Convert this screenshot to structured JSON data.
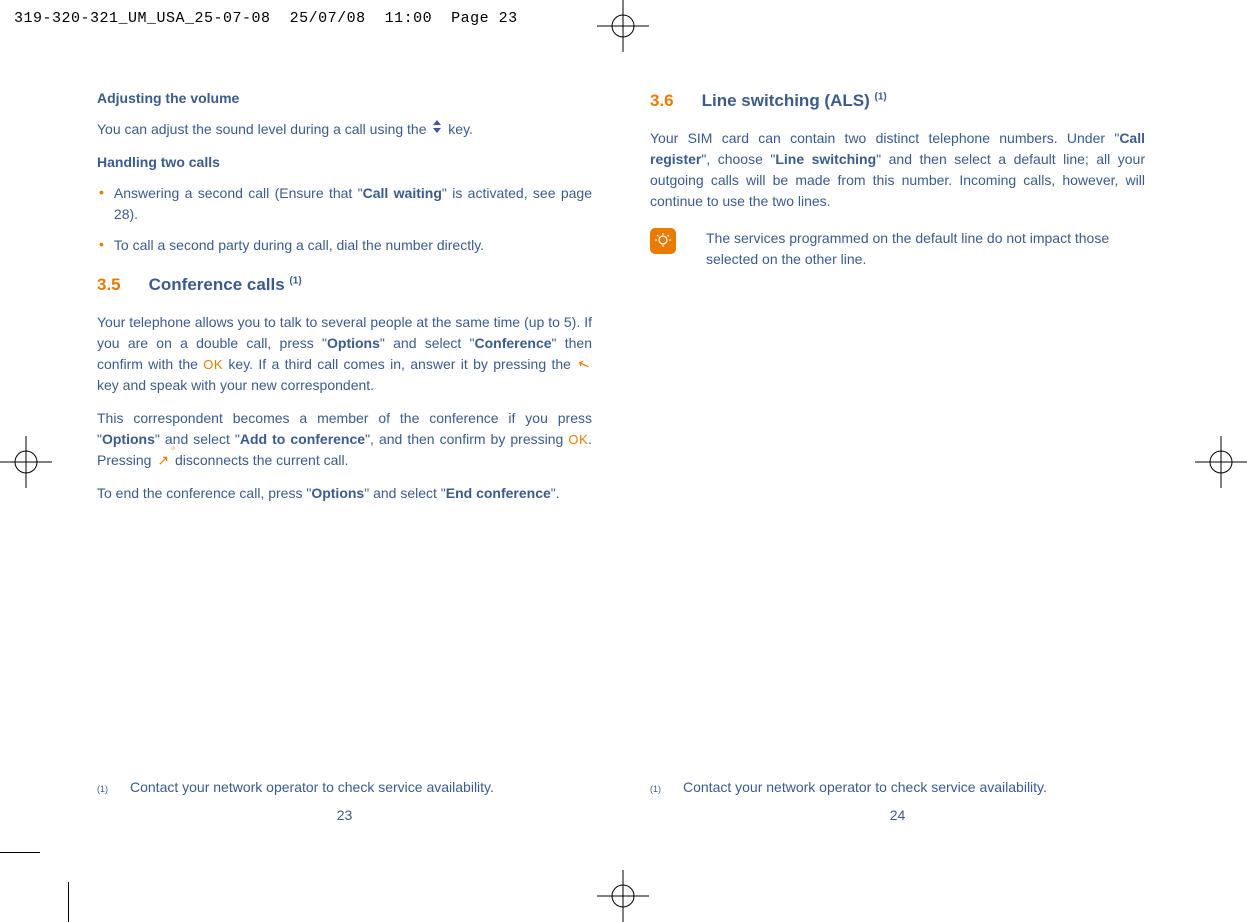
{
  "header": {
    "filename": "319-320-321_UM_USA_25-07-08",
    "date": "25/07/08",
    "time": "11:00",
    "page_label": "Page 23"
  },
  "left": {
    "h_volume": "Adjusting the volume",
    "p_volume_a": "You can adjust the sound level during a call using the ",
    "p_volume_b": " key.",
    "h_twocalls": "Handling two calls",
    "bullets": [
      {
        "pre": "Answering a second call (Ensure that \"",
        "bold": "Call waiting",
        "post": "\" is activated, see page 28)."
      },
      {
        "pre": "To call a second party during a call, dial the number directly.",
        "bold": "",
        "post": ""
      }
    ],
    "chapter_num": "3.5",
    "chapter_title": "Conference calls ",
    "chapter_sup": "(1)",
    "p_conf1_a": "Your telephone allows you to talk to several people at the same time (up to 5). If you are on a double call, press \"",
    "p_conf1_b": "Options",
    "p_conf1_c": "\" and select \"",
    "p_conf1_d": "Conference",
    "p_conf1_e": "\" then confirm with the ",
    "p_conf1_f": " key. If a third call comes in, answer it by pressing the ",
    "p_conf1_g": " key and speak with your new correspondent.",
    "p_conf2_a": "This correspondent becomes a member of the conference if you press \"",
    "p_conf2_b": "Options",
    "p_conf2_c": "\" and select \"",
    "p_conf2_d": "Add to conference",
    "p_conf2_e": "\", and then confirm by pressing ",
    "p_conf2_f": ". Pressing ",
    "p_conf2_g": " disconnects the current call.",
    "p_conf3_a": "To end the conference call, press \"",
    "p_conf3_b": "Options",
    "p_conf3_c": "\" and select \"",
    "p_conf3_d": "End conference",
    "p_conf3_e": "\".",
    "footnote_sup": "(1)",
    "footnote": "Contact your network operator to check service availability.",
    "page_num": "23"
  },
  "right": {
    "chapter_num": "3.6",
    "chapter_title": "Line switching (ALS) ",
    "chapter_sup": "(1)",
    "p_als_a": "Your SIM card can contain two distinct telephone numbers. Under \"",
    "p_als_b": "Call register",
    "p_als_c": "\", choose \"",
    "p_als_d": "Line switching",
    "p_als_e": "\" and then select a default line; all your outgoing calls will be made from this number. Incoming calls, however, will continue to use the two lines.",
    "note": "The services programmed on the default line do not impact those selected on the other line.",
    "footnote_sup": "(1)",
    "footnote": "Contact your network operator to check service availability.",
    "page_num": "24"
  },
  "icons": {
    "ok_label": "OK"
  }
}
